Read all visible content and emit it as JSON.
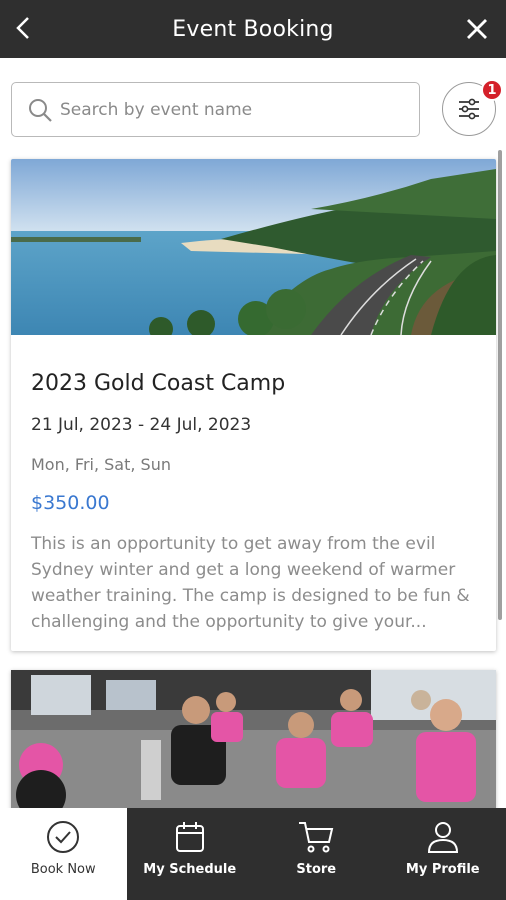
{
  "header": {
    "title": "Event Booking",
    "back_icon": "chevron-left-icon",
    "close_icon": "close-icon"
  },
  "search": {
    "placeholder": "Search by event name",
    "value": ""
  },
  "filter": {
    "icon": "sliders-icon",
    "badge_count": "1",
    "badge_color": "#d4202a"
  },
  "events": [
    {
      "name": "2023 Gold Coast Camp",
      "dates": "21 Jul, 2023 - 24 Jul, 2023",
      "days": "Mon, Fri, Sat, Sun",
      "price": "$350.00",
      "description": "This is an opportunity to get away from the evil Sydney winter and get a long weekend of warmer weather training.   The camp is designed to be fun & challenging and the opportunity to give your..."
    }
  ],
  "nav": {
    "items": [
      {
        "label": "Book Now",
        "icon": "check-circle-icon",
        "active": true
      },
      {
        "label": "My Schedule",
        "icon": "calendar-icon",
        "active": false
      },
      {
        "label": "Store",
        "icon": "cart-icon",
        "active": false
      },
      {
        "label": "My Profile",
        "icon": "user-icon",
        "active": false
      }
    ]
  },
  "colors": {
    "header_bg": "#2f2f2f",
    "price": "#3a78d0",
    "badge": "#d4202a"
  }
}
